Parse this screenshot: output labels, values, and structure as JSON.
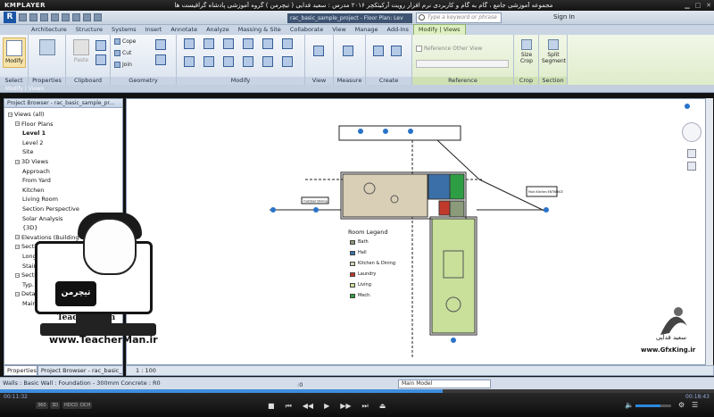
{
  "player": {
    "logo": "KMPLAYER",
    "title": "مجموعه آموزشی جامع ، گام به گام و کاربردی نرم افزار رویت آرکیتکچر ۲۰۱۶ مدرس : سعید فدایی ( تیچرمن ) گروه آموزشی پادشاه گرافیست ها",
    "time_current": "00:11:32",
    "time_total": "00:18:43",
    "progress": 0.62,
    "volume": 0.7,
    "tags": [
      "360",
      "3D",
      "HDCD",
      "DCH"
    ]
  },
  "revit": {
    "doc_title": "rac_basic_sample_project - Floor Plan: Lev",
    "search_placeholder": "Type a keyword or phrase",
    "sign_in": "Sign In",
    "tabs": [
      "Architecture",
      "Structure",
      "Systems",
      "Insert",
      "Annotate",
      "Analyze",
      "Massing & Site",
      "Collaborate",
      "View",
      "Manage",
      "Add-Ins",
      "Modify | Views"
    ],
    "active_tab": "Modify | Views",
    "panels": {
      "select": "Select",
      "properties": "Properties",
      "clipboard": "Clipboard",
      "geometry": "Geometry",
      "modify": "Modify",
      "view": "View",
      "measure": "Measure",
      "create": "Create",
      "reference": "Reference",
      "crop": "Crop",
      "section": "Section"
    },
    "buttons": {
      "modify": "Modify",
      "paste": "Paste",
      "cope": "Cope",
      "cut": "Cut",
      "join": "Join",
      "reference_other_view": "Reference Other View",
      "size_crop": "Size Crop",
      "split_segment": "Split Segment"
    },
    "context_bar": "Modify | Views",
    "browser": {
      "title": "Project Browser - rac_basic_sample_pr...",
      "items": [
        {
          "label": "Views (all)",
          "level": 0,
          "bold": false
        },
        {
          "label": "Floor Plans",
          "level": 1,
          "bold": false
        },
        {
          "label": "Level 1",
          "level": 2,
          "bold": true
        },
        {
          "label": "Level 2",
          "level": 2,
          "bold": false
        },
        {
          "label": "Site",
          "level": 2,
          "bold": false
        },
        {
          "label": "3D Views",
          "level": 1,
          "bold": false
        },
        {
          "label": "Approach",
          "level": 2,
          "bold": false
        },
        {
          "label": "From Yard",
          "level": 2,
          "bold": false
        },
        {
          "label": "Kitchen",
          "level": 2,
          "bold": false
        },
        {
          "label": "Living Room",
          "level": 2,
          "bold": false
        },
        {
          "label": "Section Perspective",
          "level": 2,
          "bold": false
        },
        {
          "label": "Solar Analysis",
          "level": 2,
          "bold": false
        },
        {
          "label": "{3D}",
          "level": 2,
          "bold": false
        },
        {
          "label": "Elevations (Building Elevation)",
          "level": 1,
          "bold": false
        },
        {
          "label": "Sections",
          "level": 1,
          "bold": false
        },
        {
          "label": "Longitudinal",
          "level": 2,
          "bold": false
        },
        {
          "label": "Stair Section",
          "level": 2,
          "bold": false
        },
        {
          "label": "Sections (Wall Section)",
          "level": 1,
          "bold": false
        },
        {
          "label": "Typ. Wall Section",
          "level": 2,
          "bold": false
        },
        {
          "label": "Detail Views (Detail)",
          "level": 1,
          "bold": false
        },
        {
          "label": "Main Stair Detail",
          "level": 2,
          "bold": false
        }
      ],
      "tab_properties": "Properties",
      "tab_browser": "Project Browser - rac_basic_..."
    },
    "view_scale": "1 : 100",
    "status_text": "Walls : Basic Wall : Foundation - 300mm Concrete : R0",
    "status_zero": ":0",
    "status_model": "Main Model",
    "room_legend": {
      "title": "Room Legend",
      "items": [
        {
          "label": "Bath",
          "color": "#8a9a7a"
        },
        {
          "label": "Hall",
          "color": "#3b6fa8"
        },
        {
          "label": "Kitchen & Dining",
          "color": "#d8cfb8"
        },
        {
          "label": "Laundry",
          "color": "#c0392b"
        },
        {
          "label": "Living",
          "color": "#c8e09a"
        },
        {
          "label": "Mech.",
          "color": "#2e9e44"
        }
      ]
    },
    "plan_tags": [
      "Outdoor Dining",
      "Main Kitchen ENTRANCE"
    ]
  },
  "watermark": {
    "logo_text": "تیچرمن",
    "name": "Teacher Man",
    "url": "www.TeacherMan.ir",
    "gfx_name": "سعید فدایی",
    "gfx_url": "www.GfxKing.ir"
  }
}
